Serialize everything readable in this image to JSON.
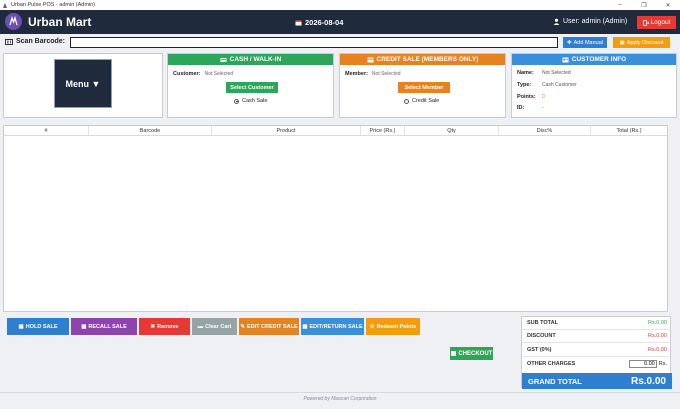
{
  "window": {
    "title": "Urban Pulse POS - admin (Admin)",
    "controls": [
      "minimize-icon",
      "maximize-icon",
      "close-icon"
    ]
  },
  "header": {
    "brand": "Urban Mart",
    "date": "2026-08-04",
    "user": "User: admin (Admin)",
    "logout_label": "Logout"
  },
  "barcode": {
    "label": "Scan Barcode:",
    "value": "",
    "add_manual_label": "Add Manual",
    "apply_discount_label": "Apply Discount"
  },
  "menu": {
    "label": "Menu ▼"
  },
  "cash_panel": {
    "title": "CASH / WALK-IN",
    "customer_label": "Customer:",
    "customer_value": "Not Selected",
    "button_label": "Select Customer",
    "radio_label": "Cash Sale",
    "radio_checked": true
  },
  "credit_panel": {
    "title": "CREDIT SALE (MEMBERS ONLY)",
    "member_label": "Member:",
    "member_value": "Not Selected",
    "button_label": "Select Member",
    "radio_label": "Credit Sale",
    "radio_checked": false
  },
  "customer_info": {
    "title": "CUSTOMER INFO",
    "rows": [
      {
        "label": "Name:",
        "value": "Not Selected"
      },
      {
        "label": "Type:",
        "value": "Cash Customer"
      },
      {
        "label": "Points:",
        "value": "0"
      },
      {
        "label": "ID:",
        "value": "-"
      }
    ]
  },
  "cart": {
    "columns": [
      "#",
      "Barcode",
      "Product",
      "Price (Rs.)",
      "Qty",
      "Disc%",
      "Total (Rs.)"
    ],
    "rows": []
  },
  "actions": {
    "hold": "HOLD SALE",
    "recall": "RECALL SALE",
    "remove": "Remove",
    "clear": "Clear Cart",
    "edit_credit": "EDIT CREDIT SALE",
    "edit_return": "EDIT/RETURN SALE",
    "redeem": "Redeem Points",
    "checkout": "CHECKOUT"
  },
  "totals": {
    "subtotal_label": "SUB TOTAL",
    "subtotal_value": "Rs.0.00",
    "discount_label": "DISCOUNT",
    "discount_value": "Rs.0.00",
    "gst_label": "GST (0%)",
    "gst_value": "Rs.0.00",
    "other_label": "OTHER CHARGES",
    "other_value": "0.00",
    "other_unit": "Rs.",
    "grand_label": "GRAND TOTAL",
    "grand_value": "Rs.0.00"
  },
  "footer": "Powered by Meecan Corporation",
  "colors": {
    "header_bg": "#1f2a3c",
    "green": "#2ea65a",
    "orange": "#e58321",
    "blue": "#2f7fd0",
    "red": "#e53935",
    "purple": "#8e44ad",
    "gray": "#95a5a6"
  }
}
